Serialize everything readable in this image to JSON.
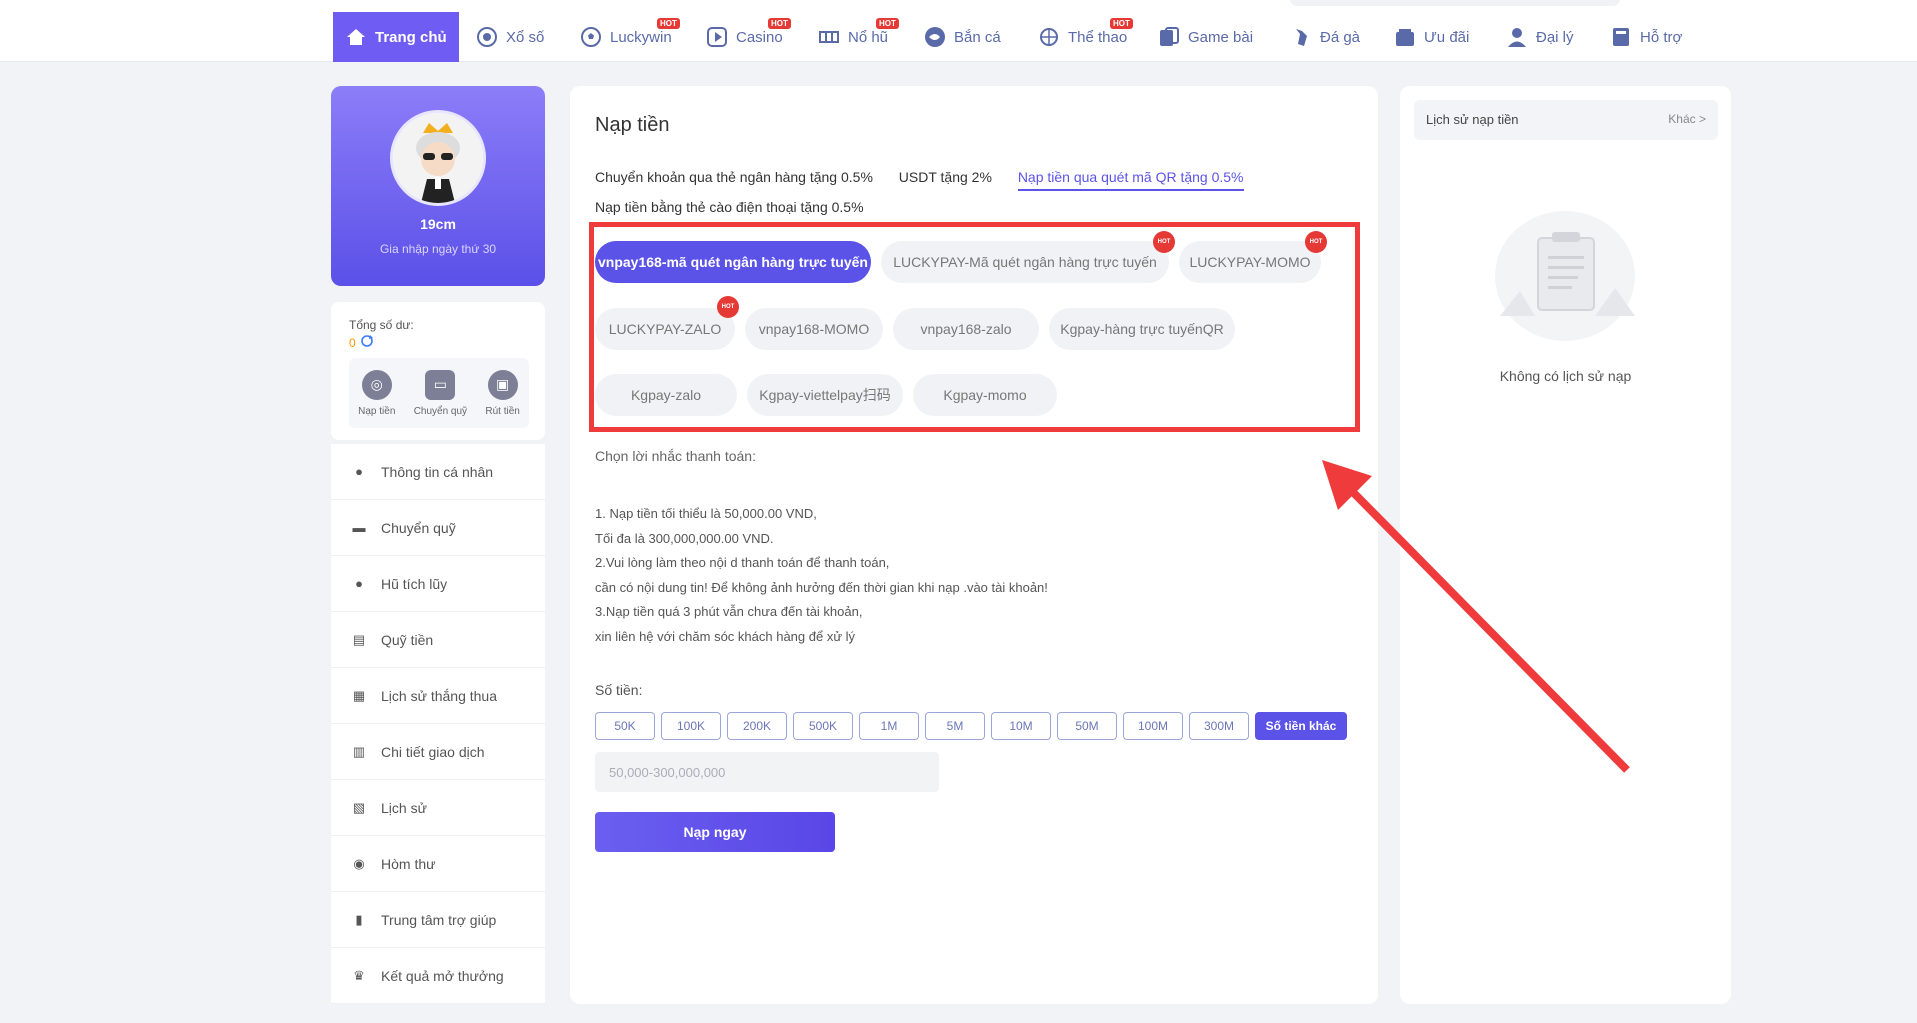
{
  "nav": {
    "items": [
      {
        "label": "Trang chủ",
        "icon": "home-icon",
        "active": true
      },
      {
        "label": "Xổ số",
        "icon": "lottery-icon"
      },
      {
        "label": "Luckywin",
        "icon": "soccer-ball-icon",
        "badge": "HOT"
      },
      {
        "label": "Casino",
        "icon": "play-icon",
        "badge": "HOT"
      },
      {
        "label": "Nổ hũ",
        "icon": "slot-icon",
        "badge": "HOT"
      },
      {
        "label": "Bắn cá",
        "icon": "fish-icon"
      },
      {
        "label": "Thể thao",
        "icon": "sport-icon",
        "badge": "HOT"
      },
      {
        "label": "Game bài",
        "icon": "cards-icon"
      },
      {
        "label": "Đá gà",
        "icon": "rooster-icon"
      },
      {
        "label": "Ưu đãi",
        "icon": "gift-icon"
      },
      {
        "label": "Đại lý",
        "icon": "agent-icon"
      },
      {
        "label": "Hỗ trợ",
        "icon": "support-icon"
      }
    ]
  },
  "profile": {
    "username": "19cm",
    "joined": "Gia nhập ngày thứ 30"
  },
  "balance": {
    "label": "Tổng số dư:",
    "value": "0",
    "actions": [
      {
        "label": "Nạp tiền",
        "icon": "deposit-icon"
      },
      {
        "label": "Chuyển quỹ",
        "icon": "wallet-icon"
      },
      {
        "label": "Rút tiền",
        "icon": "withdraw-icon"
      }
    ]
  },
  "menu": [
    {
      "label": "Thông tin cá nhân",
      "icon": "user-icon"
    },
    {
      "label": "Chuyển quỹ",
      "icon": "wallet-icon"
    },
    {
      "label": "Hũ tích lũy",
      "icon": "jar-icon"
    },
    {
      "label": "Quỹ tiền",
      "icon": "fund-icon"
    },
    {
      "label": "Lịch sử thắng thua",
      "icon": "history-icon"
    },
    {
      "label": "Chi tiết giao dịch",
      "icon": "transactions-icon"
    },
    {
      "label": "Lịch sử",
      "icon": "records-icon"
    },
    {
      "label": "Hòm thư",
      "icon": "mail-icon"
    },
    {
      "label": "Trung tâm trợ giúp",
      "icon": "help-icon"
    },
    {
      "label": "Kết quả mở thưởng",
      "icon": "trophy-icon"
    }
  ],
  "main": {
    "title": "Nạp tiền",
    "tabs": [
      {
        "label": "Chuyển khoản qua thẻ ngân hàng tặng 0.5%"
      },
      {
        "label": "USDT tặng 2%"
      },
      {
        "label": "Nạp tiền qua quét mã QR tặng 0.5%",
        "active": true
      },
      {
        "label": "Nạp tiền bằng thẻ cào điện thoại tặng 0.5%"
      }
    ],
    "methods": [
      {
        "label": "vnpay168-mã quét ngân hàng trực tuyến",
        "selected": true
      },
      {
        "label": "LUCKYPAY-Mã quét ngân hàng trực tuyến",
        "hot": true
      },
      {
        "label": "LUCKYPAY-MOMO",
        "hot": true
      },
      {
        "label": "LUCKYPAY-ZALO",
        "hot": true
      },
      {
        "label": "vnpay168-MOMO"
      },
      {
        "label": "vnpay168-zalo"
      },
      {
        "label": "Kgpay-hàng trực tuyếnQR"
      },
      {
        "label": "Kgpay-zalo"
      },
      {
        "label": "Kgpay-viettelpay扫码"
      },
      {
        "label": "Kgpay-momo"
      }
    ],
    "hint_title": "Chọn lời nhắc thanh toán:",
    "hints": [
      "1. Nạp tiền tối thiểu là 50,000.00 VND,",
      "Tối đa là 300,000,000.00 VND.",
      "2.Vui lòng làm theo nội d thanh toán để thanh toán,",
      "cần có nội dung tin! Để không ảnh hưởng đến thời gian khi nạp .vào tài khoản!",
      "3.Nạp tiền quá 3 phút vẫn chưa đến tài khoản,",
      "xin liên hệ với chăm sóc khách hàng để xử lý"
    ],
    "amount_label": "Số tiền:",
    "amount_chips": [
      "50K",
      "100K",
      "200K",
      "500K",
      "1M",
      "5M",
      "10M",
      "50M",
      "100M",
      "300M",
      "Số tiền khác"
    ],
    "amount_placeholder": "50,000-300,000,000",
    "submit_label": "Nạp ngay"
  },
  "history": {
    "title": "Lịch sử nạp tiền",
    "more": "Khác >",
    "empty": "Không có lịch sử nạp"
  },
  "hot_badge": "HOT",
  "colors": {
    "accent": "#5b52e8",
    "annotation": "#ef3b3b",
    "hot": "#e53935"
  }
}
